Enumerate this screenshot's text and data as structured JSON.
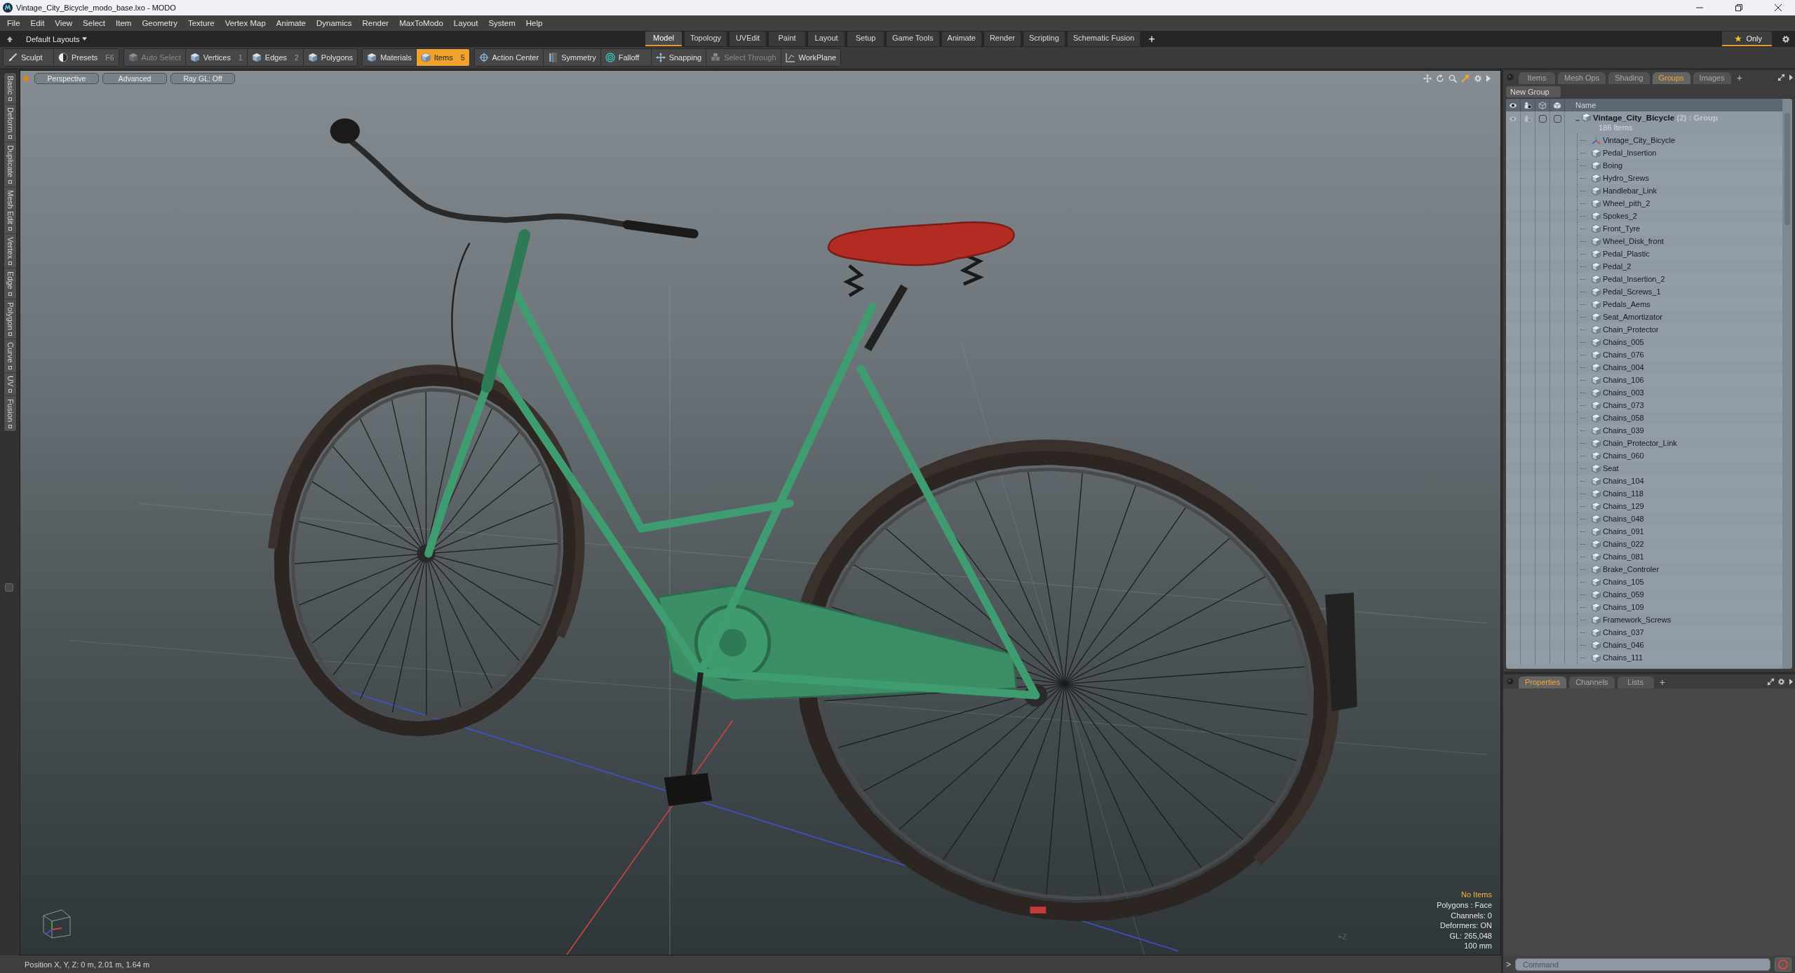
{
  "window": {
    "title": "Vintage_City_Bicycle_modo_base.lxo - MODO"
  },
  "menu_bar": [
    "File",
    "Edit",
    "View",
    "Select",
    "Item",
    "Geometry",
    "Texture",
    "Vertex Map",
    "Animate",
    "Dynamics",
    "Render",
    "MaxToModo",
    "Layout",
    "System",
    "Help"
  ],
  "layout_bar": {
    "preset": "Default Layouts",
    "tabs": [
      {
        "label": "Model",
        "selected": true
      },
      {
        "label": "Topology",
        "selected": false
      },
      {
        "label": "UVEdit",
        "selected": false
      },
      {
        "label": "Paint",
        "selected": false
      },
      {
        "label": "Layout",
        "selected": false
      },
      {
        "label": "Setup",
        "selected": false
      },
      {
        "label": "Game Tools",
        "selected": false
      },
      {
        "label": "Animate",
        "selected": false
      },
      {
        "label": "Render",
        "selected": false
      },
      {
        "label": "Scripting",
        "selected": false
      },
      {
        "label": "Schematic Fusion",
        "selected": false
      }
    ],
    "add_tab": "+",
    "only_toggle": {
      "label": "Only",
      "on": true
    }
  },
  "toolbar": {
    "groups": [
      {
        "buttons": [
          {
            "label": "Sculpt",
            "kind": "brush",
            "selected": false,
            "disabled": false
          },
          {
            "label": "Presets",
            "shortcut": "F6",
            "kind": "sphere",
            "selected": false,
            "disabled": false
          }
        ]
      },
      {
        "buttons": [
          {
            "label": "Auto Select",
            "kind": "cube",
            "selected": false,
            "disabled": true
          },
          {
            "label": "Vertices",
            "shortcut": "1",
            "kind": "cube",
            "selected": false,
            "disabled": false
          },
          {
            "label": "Edges",
            "shortcut": "2",
            "kind": "cube",
            "selected": false,
            "disabled": false
          },
          {
            "label": "Polygons",
            "kind": "cube",
            "selected": false,
            "disabled": false
          }
        ]
      },
      {
        "buttons": [
          {
            "label": "Materials",
            "kind": "cube",
            "selected": false,
            "disabled": false
          },
          {
            "label": "Items",
            "shortcut": "5",
            "kind": "cube",
            "selected": true,
            "disabled": false
          }
        ]
      },
      {
        "buttons": [
          {
            "label": "Action Center",
            "kind": "crosshair",
            "selected": false,
            "disabled": false
          },
          {
            "label": "Symmetry",
            "kind": "symmetry",
            "selected": false,
            "disabled": false
          },
          {
            "label": "Falloff",
            "kind": "rings",
            "selected": false,
            "disabled": false
          },
          {
            "label": "Snapping",
            "kind": "snap",
            "selected": false,
            "disabled": false
          },
          {
            "label": "Select Through",
            "kind": "cubes",
            "selected": false,
            "disabled": true
          },
          {
            "label": "WorkPlane",
            "kind": "plane",
            "selected": false,
            "disabled": false
          }
        ]
      }
    ]
  },
  "left_tabs": [
    {
      "label": "Basic",
      "selected": false
    },
    {
      "label": "Deform",
      "selected": false
    },
    {
      "label": "Duplicate",
      "selected": false
    },
    {
      "label": "Mesh Edit",
      "selected": false
    },
    {
      "label": "Vertex",
      "selected": false
    },
    {
      "label": "Edge",
      "selected": false
    },
    {
      "label": "Polygon",
      "selected": false
    },
    {
      "label": "Curve",
      "selected": false
    },
    {
      "label": "UV",
      "selected": false
    },
    {
      "label": "Fusion",
      "selected": false
    }
  ],
  "viewport": {
    "view_buttons": [
      "Perspective",
      "Advanced",
      "Ray GL: Off"
    ],
    "axis_label": "+Z",
    "stats": [
      {
        "text": "No Items",
        "kind": "notice"
      },
      {
        "text": "Polygons : Face",
        "kind": "info"
      },
      {
        "text": "Channels: 0",
        "kind": "info"
      },
      {
        "text": "Deformers: ON",
        "kind": "info"
      },
      {
        "text": "GL: 265,048",
        "kind": "info"
      },
      {
        "text": "100 mm",
        "kind": "info"
      }
    ]
  },
  "groups_panel": {
    "tabs": [
      {
        "label": "Items",
        "selected": false
      },
      {
        "label": "Mesh Ops",
        "selected": false
      },
      {
        "label": "Shading",
        "selected": false
      },
      {
        "label": "Groups",
        "selected": true
      },
      {
        "label": "Images",
        "selected": false
      }
    ],
    "add_tab": "+",
    "new_group_button": "New Group",
    "name_column": "Name",
    "tree": [
      {
        "name": "Vintage_City_Bicycle",
        "count": "(2)",
        "type": ": Group",
        "summary": "186 Items",
        "expanded": true,
        "children": [
          {
            "name": "Vintage_City_Bicycle",
            "kind": "locator"
          },
          {
            "name": "Pedal_Insertion",
            "kind": "mesh"
          },
          {
            "name": "Boing",
            "kind": "mesh"
          },
          {
            "name": "Hydro_Srews",
            "kind": "mesh"
          },
          {
            "name": "Handlebar_Link",
            "kind": "mesh"
          },
          {
            "name": "Wheel_pith_2",
            "kind": "mesh"
          },
          {
            "name": "Spokes_2",
            "kind": "mesh"
          },
          {
            "name": "Front_Tyre",
            "kind": "mesh"
          },
          {
            "name": "Wheel_Disk_front",
            "kind": "mesh"
          },
          {
            "name": "Pedal_Plastic",
            "kind": "mesh"
          },
          {
            "name": "Pedal_2",
            "kind": "mesh"
          },
          {
            "name": "Pedal_Insertion_2",
            "kind": "mesh"
          },
          {
            "name": "Pedal_Screws_1",
            "kind": "mesh"
          },
          {
            "name": "Pedals_Aems",
            "kind": "mesh"
          },
          {
            "name": "Seat_Amortizator",
            "kind": "mesh"
          },
          {
            "name": "Chain_Protector",
            "kind": "mesh"
          },
          {
            "name": "Chains_005",
            "kind": "mesh"
          },
          {
            "name": "Chains_076",
            "kind": "mesh"
          },
          {
            "name": "Chains_004",
            "kind": "mesh"
          },
          {
            "name": "Chains_106",
            "kind": "mesh"
          },
          {
            "name": "Chains_003",
            "kind": "mesh"
          },
          {
            "name": "Chains_073",
            "kind": "mesh"
          },
          {
            "name": "Chains_058",
            "kind": "mesh"
          },
          {
            "name": "Chains_039",
            "kind": "mesh"
          },
          {
            "name": "Chain_Protector_Link",
            "kind": "mesh"
          },
          {
            "name": "Chains_060",
            "kind": "mesh"
          },
          {
            "name": "Seat",
            "kind": "mesh"
          },
          {
            "name": "Chains_104",
            "kind": "mesh"
          },
          {
            "name": "Chains_118",
            "kind": "mesh"
          },
          {
            "name": "Chains_129",
            "kind": "mesh"
          },
          {
            "name": "Chains_048",
            "kind": "mesh"
          },
          {
            "name": "Chains_091",
            "kind": "mesh"
          },
          {
            "name": "Chains_022",
            "kind": "mesh"
          },
          {
            "name": "Chains_081",
            "kind": "mesh"
          },
          {
            "name": "Brake_Controler",
            "kind": "mesh"
          },
          {
            "name": "Chains_105",
            "kind": "mesh"
          },
          {
            "name": "Chains_059",
            "kind": "mesh"
          },
          {
            "name": "Chains_109",
            "kind": "mesh"
          },
          {
            "name": "Framework_Screws",
            "kind": "mesh"
          },
          {
            "name": "Chains_037",
            "kind": "mesh"
          },
          {
            "name": "Chains_046",
            "kind": "mesh"
          },
          {
            "name": "Chains_111",
            "kind": "mesh"
          }
        ]
      }
    ]
  },
  "properties_panel": {
    "tabs": [
      {
        "label": "Properties",
        "selected": true
      },
      {
        "label": "Channels",
        "selected": false
      },
      {
        "label": "Lists",
        "selected": false
      }
    ],
    "add_tab": "+"
  },
  "command_bar": {
    "prompt": ">",
    "placeholder": "Command"
  },
  "status_bar": {
    "position": "Position X, Y, Z: 0 m, 2.01 m, 1.64 m"
  }
}
